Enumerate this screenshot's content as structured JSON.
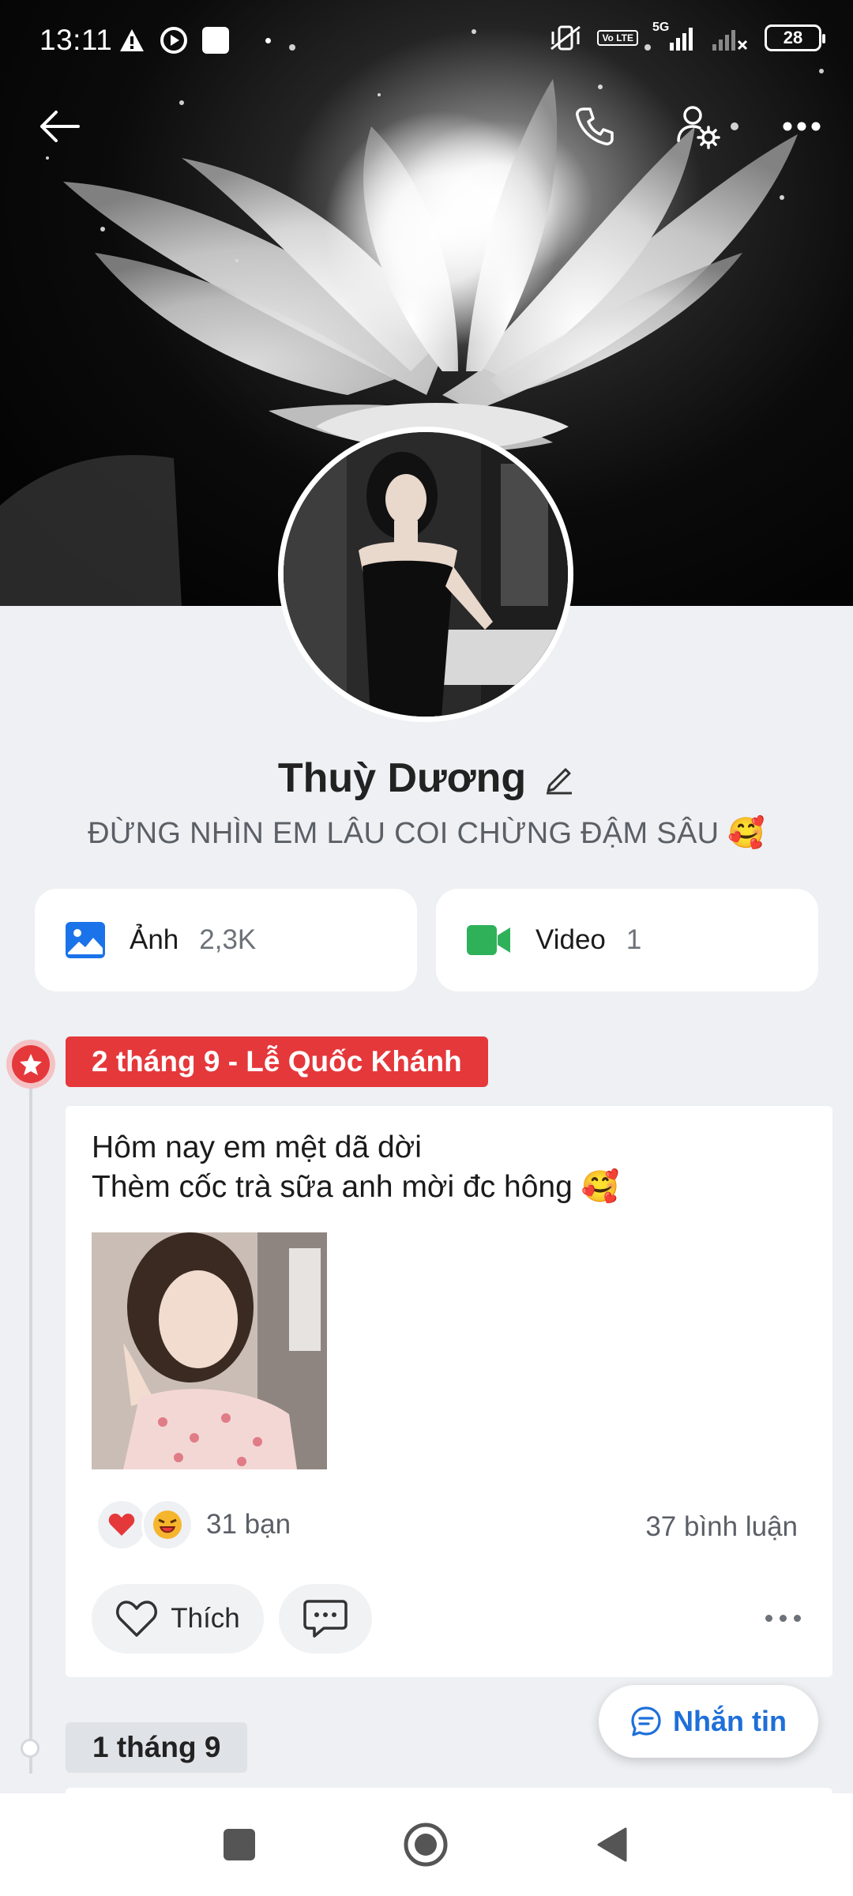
{
  "status_bar": {
    "time": "13:11",
    "network": "5G",
    "volte": "Vo LTE",
    "battery": "28"
  },
  "header_icons": {
    "back": "back-arrow-icon",
    "call": "phone-icon",
    "settings": "user-settings-icon",
    "more": "more-icon"
  },
  "profile": {
    "name": "Thuỳ Dương",
    "bio": "ĐỪNG NHÌN EM LÂU COI CHỪNG ĐẬM SÂU 🥰"
  },
  "media": {
    "photos_label": "Ảnh",
    "photos_count": "2,3K",
    "videos_label": "Video",
    "videos_count": "1"
  },
  "timeline": {
    "post_date": "2 tháng 9 - Lễ Quốc Khánh",
    "post_line1": "Hôm nay em mệt dã dời",
    "post_line2": "Thèm cốc trà sữa anh mời đc hông 🥰",
    "reactions_friends": "31 bạn",
    "comments": "37 bình luận",
    "like_label": "Thích",
    "next_date": "1 tháng 9"
  },
  "message_button": "Nhắn tin",
  "colors": {
    "accent_red": "#e5383b",
    "accent_blue": "#1e6fd9",
    "video_green": "#2fb15a",
    "photo_blue": "#1a73e8"
  }
}
